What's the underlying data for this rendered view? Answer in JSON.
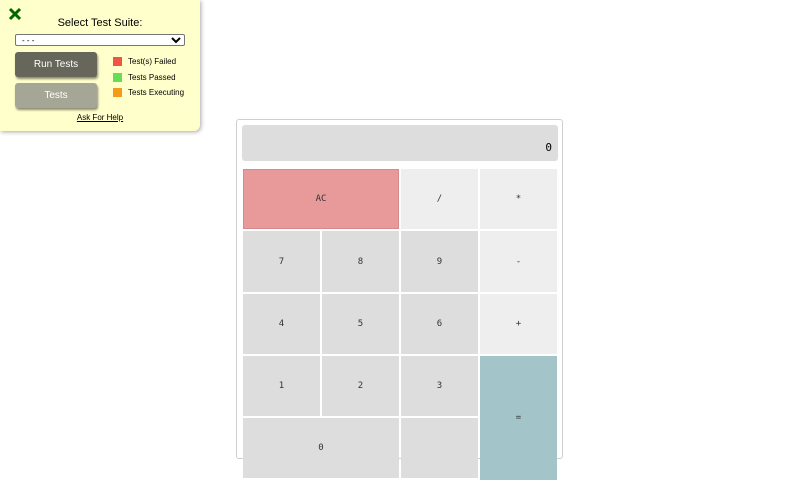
{
  "test_panel": {
    "title": "Select Test Suite:",
    "select_value": "- - -",
    "run_label": "Run Tests",
    "tests_label": "Tests",
    "legend": [
      {
        "label": "Test(s) Failed",
        "color": "#ee5544"
      },
      {
        "label": "Tests Passed",
        "color": "#66dd55"
      },
      {
        "label": "Tests Executing",
        "color": "#f59a1a"
      }
    ],
    "help_label": "Ask For Help",
    "close_icon": "close-x-icon",
    "close_color": "#006600"
  },
  "calculator": {
    "display_value": "0",
    "keys": {
      "clear": "AC",
      "divide": "/",
      "multiply": "*",
      "seven": "7",
      "eight": "8",
      "nine": "9",
      "subtract": "-",
      "four": "4",
      "five": "5",
      "six": "6",
      "add": "+",
      "one": "1",
      "two": "2",
      "three": "3",
      "equals": "=",
      "zero": "0"
    },
    "colors": {
      "clear": "#e89a9a",
      "equals": "#a3c5c9",
      "number": "#dddddd",
      "operator": "#eeeeee"
    }
  }
}
